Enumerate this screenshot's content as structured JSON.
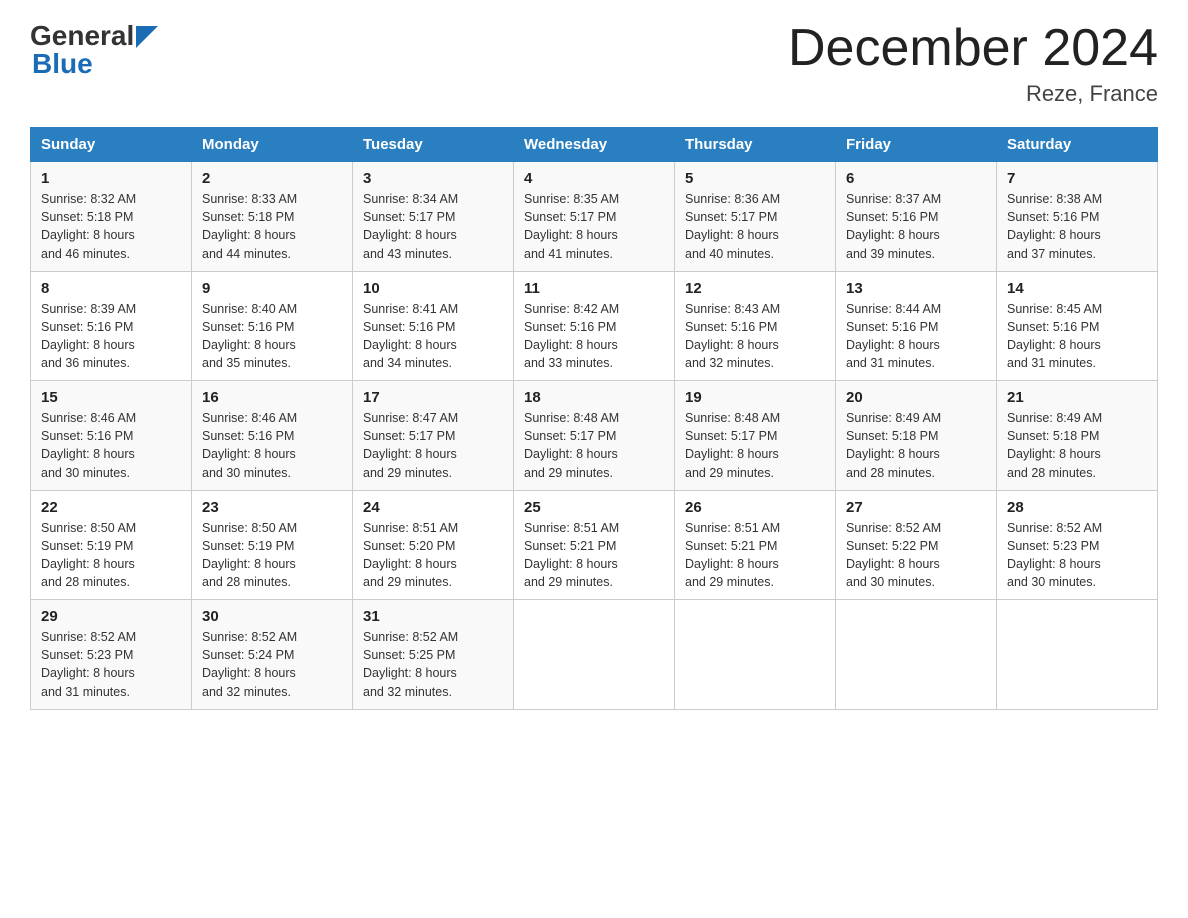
{
  "logo": {
    "general": "General",
    "blue": "Blue"
  },
  "header": {
    "title": "December 2024",
    "subtitle": "Reze, France"
  },
  "days_of_week": [
    "Sunday",
    "Monday",
    "Tuesday",
    "Wednesday",
    "Thursday",
    "Friday",
    "Saturday"
  ],
  "weeks": [
    [
      {
        "day": "1",
        "sunrise": "8:32 AM",
        "sunset": "5:18 PM",
        "daylight": "8 hours and 46 minutes."
      },
      {
        "day": "2",
        "sunrise": "8:33 AM",
        "sunset": "5:18 PM",
        "daylight": "8 hours and 44 minutes."
      },
      {
        "day": "3",
        "sunrise": "8:34 AM",
        "sunset": "5:17 PM",
        "daylight": "8 hours and 43 minutes."
      },
      {
        "day": "4",
        "sunrise": "8:35 AM",
        "sunset": "5:17 PM",
        "daylight": "8 hours and 41 minutes."
      },
      {
        "day": "5",
        "sunrise": "8:36 AM",
        "sunset": "5:17 PM",
        "daylight": "8 hours and 40 minutes."
      },
      {
        "day": "6",
        "sunrise": "8:37 AM",
        "sunset": "5:16 PM",
        "daylight": "8 hours and 39 minutes."
      },
      {
        "day": "7",
        "sunrise": "8:38 AM",
        "sunset": "5:16 PM",
        "daylight": "8 hours and 37 minutes."
      }
    ],
    [
      {
        "day": "8",
        "sunrise": "8:39 AM",
        "sunset": "5:16 PM",
        "daylight": "8 hours and 36 minutes."
      },
      {
        "day": "9",
        "sunrise": "8:40 AM",
        "sunset": "5:16 PM",
        "daylight": "8 hours and 35 minutes."
      },
      {
        "day": "10",
        "sunrise": "8:41 AM",
        "sunset": "5:16 PM",
        "daylight": "8 hours and 34 minutes."
      },
      {
        "day": "11",
        "sunrise": "8:42 AM",
        "sunset": "5:16 PM",
        "daylight": "8 hours and 33 minutes."
      },
      {
        "day": "12",
        "sunrise": "8:43 AM",
        "sunset": "5:16 PM",
        "daylight": "8 hours and 32 minutes."
      },
      {
        "day": "13",
        "sunrise": "8:44 AM",
        "sunset": "5:16 PM",
        "daylight": "8 hours and 31 minutes."
      },
      {
        "day": "14",
        "sunrise": "8:45 AM",
        "sunset": "5:16 PM",
        "daylight": "8 hours and 31 minutes."
      }
    ],
    [
      {
        "day": "15",
        "sunrise": "8:46 AM",
        "sunset": "5:16 PM",
        "daylight": "8 hours and 30 minutes."
      },
      {
        "day": "16",
        "sunrise": "8:46 AM",
        "sunset": "5:16 PM",
        "daylight": "8 hours and 30 minutes."
      },
      {
        "day": "17",
        "sunrise": "8:47 AM",
        "sunset": "5:17 PM",
        "daylight": "8 hours and 29 minutes."
      },
      {
        "day": "18",
        "sunrise": "8:48 AM",
        "sunset": "5:17 PM",
        "daylight": "8 hours and 29 minutes."
      },
      {
        "day": "19",
        "sunrise": "8:48 AM",
        "sunset": "5:17 PM",
        "daylight": "8 hours and 29 minutes."
      },
      {
        "day": "20",
        "sunrise": "8:49 AM",
        "sunset": "5:18 PM",
        "daylight": "8 hours and 28 minutes."
      },
      {
        "day": "21",
        "sunrise": "8:49 AM",
        "sunset": "5:18 PM",
        "daylight": "8 hours and 28 minutes."
      }
    ],
    [
      {
        "day": "22",
        "sunrise": "8:50 AM",
        "sunset": "5:19 PM",
        "daylight": "8 hours and 28 minutes."
      },
      {
        "day": "23",
        "sunrise": "8:50 AM",
        "sunset": "5:19 PM",
        "daylight": "8 hours and 28 minutes."
      },
      {
        "day": "24",
        "sunrise": "8:51 AM",
        "sunset": "5:20 PM",
        "daylight": "8 hours and 29 minutes."
      },
      {
        "day": "25",
        "sunrise": "8:51 AM",
        "sunset": "5:21 PM",
        "daylight": "8 hours and 29 minutes."
      },
      {
        "day": "26",
        "sunrise": "8:51 AM",
        "sunset": "5:21 PM",
        "daylight": "8 hours and 29 minutes."
      },
      {
        "day": "27",
        "sunrise": "8:52 AM",
        "sunset": "5:22 PM",
        "daylight": "8 hours and 30 minutes."
      },
      {
        "day": "28",
        "sunrise": "8:52 AM",
        "sunset": "5:23 PM",
        "daylight": "8 hours and 30 minutes."
      }
    ],
    [
      {
        "day": "29",
        "sunrise": "8:52 AM",
        "sunset": "5:23 PM",
        "daylight": "8 hours and 31 minutes."
      },
      {
        "day": "30",
        "sunrise": "8:52 AM",
        "sunset": "5:24 PM",
        "daylight": "8 hours and 32 minutes."
      },
      {
        "day": "31",
        "sunrise": "8:52 AM",
        "sunset": "5:25 PM",
        "daylight": "8 hours and 32 minutes."
      },
      null,
      null,
      null,
      null
    ]
  ],
  "labels": {
    "sunrise": "Sunrise:",
    "sunset": "Sunset:",
    "daylight": "Daylight:"
  }
}
